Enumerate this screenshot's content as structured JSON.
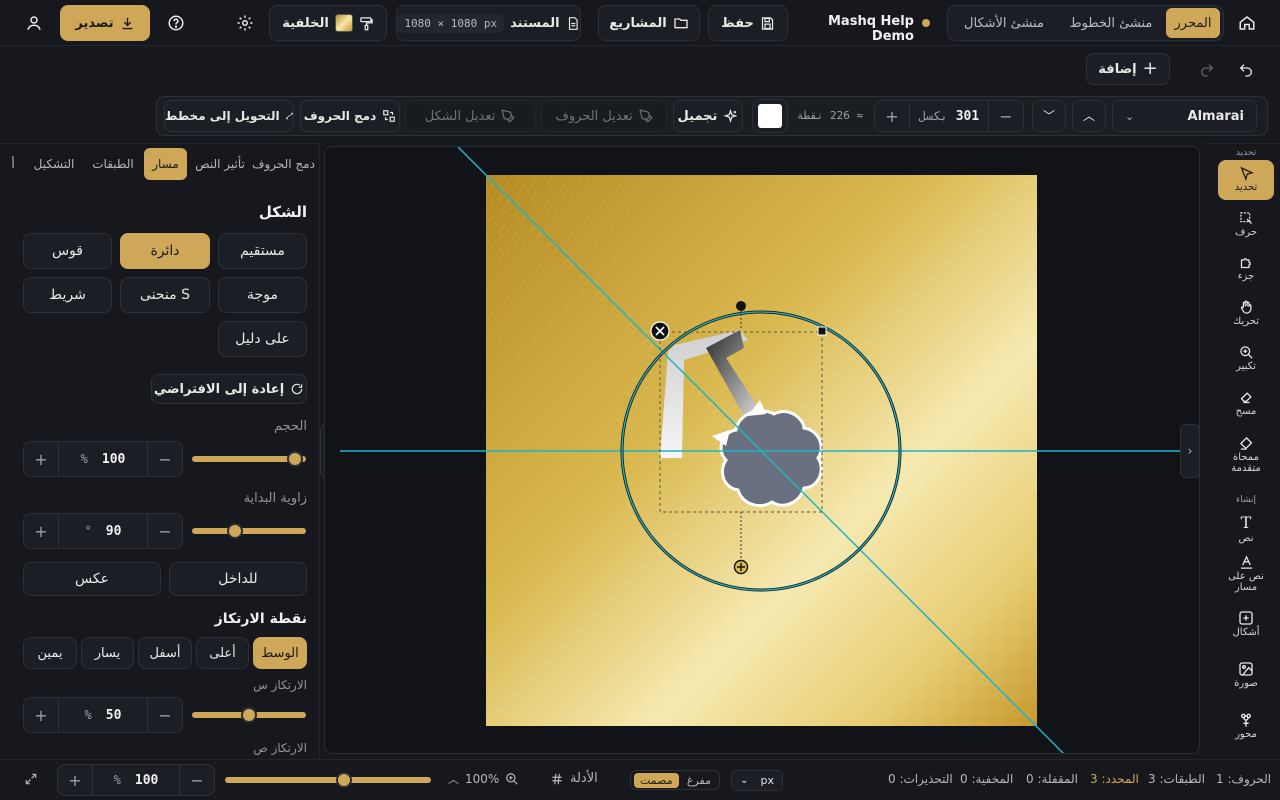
{
  "header": {
    "modes": [
      "المحرر",
      "منشئ الخطوط",
      "منشئ الأشكال"
    ],
    "project_name": "Mashq Help Demo",
    "save_label": "حفظ",
    "projects_label": "المشاريع",
    "document_label": "المستند",
    "document_size": "1080 × 1080 px",
    "background_label": "الخلفية",
    "export_label": "تصدير"
  },
  "toolbar2": {
    "add_label": "إضافة"
  },
  "text_toolbar": {
    "font_name": "Almarai",
    "font_size": "301",
    "font_size_unit": "بكسل",
    "points_readout": "≈ 226 نقطة",
    "text_color": "#ffffff",
    "beautify_label": "تجميل",
    "edit_letters_label": "تعديل الحروف",
    "edit_shape_label": "تعديل الشكل",
    "merge_letters_label": "دمج الحروف",
    "convert_to_path_label": "التحويل إلى مخطط"
  },
  "panel_tabs": [
    "دمج الحروف",
    "تأثير النص",
    "مسار",
    "الطبقات",
    "التشكيل",
    "أ"
  ],
  "panel": {
    "shape_heading": "الشكل",
    "shapes": [
      "مستقيم",
      "دائرة",
      "قوس",
      "موجة",
      "منحنى S",
      "شريط",
      "على دليل"
    ],
    "reset_label": "إعادة إلى الافتراضي",
    "size_label": "الحجم",
    "size_value": "100",
    "size_unit": "%",
    "size_fraction": 0.9,
    "start_angle_label": "زاوية البداية",
    "start_angle_value": "90",
    "start_angle_unit": "°",
    "start_angle_fraction": 0.38,
    "inside_label": "للداخل",
    "reverse_label": "عكس",
    "anchor_heading": "نقطة الارتكاز",
    "anchors": [
      "الوسط",
      "أعلى",
      "أسفل",
      "يسار",
      "يمين"
    ],
    "anchor_x_label": "الارتكاز س",
    "anchor_x_value": "50",
    "anchor_x_unit": "%",
    "anchor_x_fraction": 0.5,
    "anchor_y_label": "الارتكاز ص"
  },
  "tools": {
    "top_label": "تحديد",
    "create_label": "إنشاء",
    "items": [
      "تحديد",
      "حرف",
      "جزء",
      "تحريك",
      "تكبير",
      "مسح",
      "ممحاة متقدمة",
      "نص",
      "نص على مسار",
      "أشكال",
      "صورة",
      "محور"
    ]
  },
  "statusbar": {
    "zoom_value": "100",
    "zoom_unit": "%",
    "zoom_fraction": 0.58,
    "zoom_readout": "100%",
    "guides_label": "الأدلة",
    "fill_label": "مفرغ",
    "solid_label": "مصمت",
    "unit": "px",
    "warnings": "التحذيرات: 0",
    "hidden": "المخفية: 0",
    "locked": "المقفلة: 0",
    "selected": "المحدد: 3",
    "layers": "الطبقات: 3",
    "letters": "الحروف: 1"
  },
  "colors": {
    "accent": "#cfa759",
    "background": "#16181d",
    "guide": "#1fb3c4"
  }
}
